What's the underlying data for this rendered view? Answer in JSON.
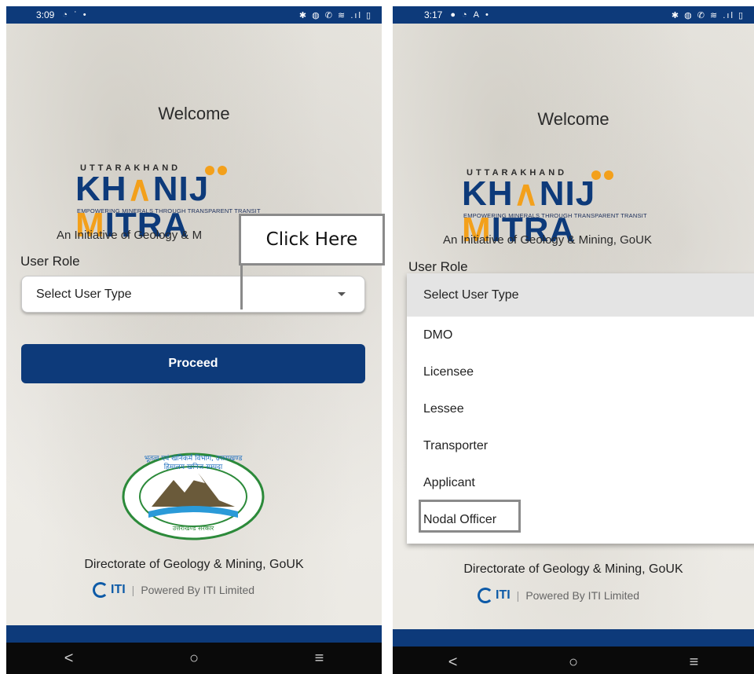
{
  "status_left": {
    "time": "3:09"
  },
  "status_right": {
    "time": "3:17"
  },
  "welcome": "Welcome",
  "logo": {
    "top_text": "UTTARAKHAND",
    "main_text_1": "KH",
    "main_text_2": "NIJ ",
    "main_text_3": "ITRA",
    "tagline": "EMPOWERING MINERALS THROUGH TRANSPARENT TRANSIT"
  },
  "initiative": "An Initiative of Geology & Mining, GoUK",
  "initiative_cut": "An Initiative of Geology & M",
  "user_role_label": "User Role",
  "select_placeholder": "Select User Type",
  "proceed_label": "Proceed",
  "callout_text": "Click Here",
  "dropdown_options": [
    "Select User Type",
    "DMO",
    "Licensee",
    "Lessee",
    "Transporter",
    "Applicant",
    "Nodal Officer"
  ],
  "directorate": "Directorate of Geology & Mining, GoUK",
  "powered": {
    "brand": "ITI",
    "text": "Powered By  ITI Limited"
  },
  "nav": {
    "back": "<",
    "home": "○",
    "menu": "≡"
  },
  "emblem_texts": {
    "top": "भूतत्व एवं खनिकर्म विभाग, उत्तराखण्ड",
    "inner": "हिमालय खनिज सम्पदा",
    "bottom": "उत्तराखण्ड सरकार"
  },
  "colors": {
    "primary": "#0d3a7a",
    "accent": "#f3a01b"
  }
}
